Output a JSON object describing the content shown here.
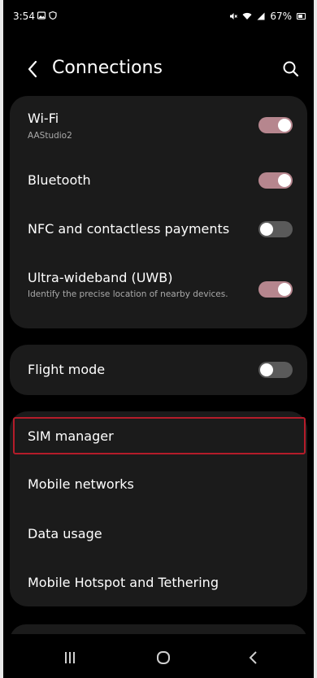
{
  "status_bar": {
    "time": "3:54",
    "battery": "67%"
  },
  "header": {
    "title": "Connections"
  },
  "card_connectivity": {
    "wifi": {
      "label": "Wi-Fi",
      "sub": "AAStudio2",
      "on": true
    },
    "bluetooth": {
      "label": "Bluetooth",
      "on": true
    },
    "nfc": {
      "label": "NFC and contactless payments",
      "on": false
    },
    "uwb": {
      "label": "Ultra-wideband (UWB)",
      "sub": "Identify the precise location of nearby devices.",
      "on": true
    }
  },
  "card_flight": {
    "flight_mode": {
      "label": "Flight mode",
      "on": false
    }
  },
  "card_network": {
    "sim_manager": "SIM manager",
    "mobile_networks": "Mobile networks",
    "data_usage": "Data usage",
    "hotspot": "Mobile Hotspot and Tethering"
  },
  "colors": {
    "toggle_on": "#b6868e",
    "toggle_off": "#5a5a5a",
    "highlight": "#b51c2a",
    "card": "#1b1b1b"
  }
}
